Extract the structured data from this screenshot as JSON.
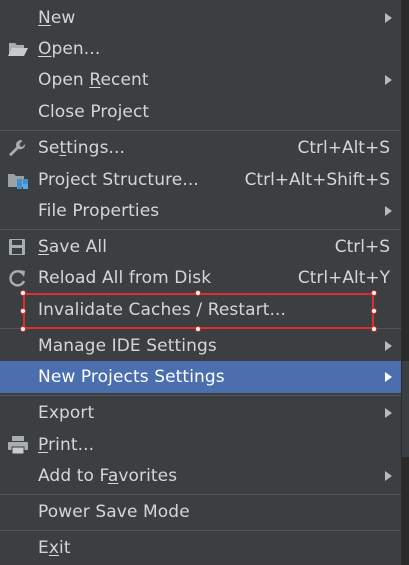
{
  "menu": {
    "items": [
      {
        "id": "new",
        "pre": "",
        "u": "N",
        "post": "ew",
        "shortcut": "",
        "submenu": true,
        "icon": "none"
      },
      {
        "id": "open",
        "pre": "",
        "u": "O",
        "post": "pen...",
        "shortcut": "",
        "submenu": false,
        "icon": "folder-open-icon"
      },
      {
        "id": "open-recent",
        "pre": "Open ",
        "u": "R",
        "post": "ecent",
        "shortcut": "",
        "submenu": true,
        "icon": "none"
      },
      {
        "id": "close-project",
        "pre": "Close Project",
        "u": "",
        "post": "",
        "shortcut": "",
        "submenu": false,
        "icon": "none"
      },
      {
        "id": "settings",
        "pre": "Se",
        "u": "t",
        "post": "tings...",
        "shortcut": "Ctrl+Alt+S",
        "submenu": false,
        "icon": "wrench-icon"
      },
      {
        "id": "project-structure",
        "pre": "Project Structure...",
        "u": "",
        "post": "",
        "shortcut": "Ctrl+Alt+Shift+S",
        "submenu": false,
        "icon": "project-structure-icon"
      },
      {
        "id": "file-properties",
        "pre": "File Properties",
        "u": "",
        "post": "",
        "shortcut": "",
        "submenu": true,
        "icon": "none"
      },
      {
        "id": "save-all",
        "pre": "",
        "u": "S",
        "post": "ave All",
        "shortcut": "Ctrl+S",
        "submenu": false,
        "icon": "save-icon"
      },
      {
        "id": "reload-all",
        "pre": "Reload All from Disk",
        "u": "",
        "post": "",
        "shortcut": "Ctrl+Alt+Y",
        "submenu": false,
        "icon": "reload-icon"
      },
      {
        "id": "invalidate-caches",
        "pre": "Invalidate Caches / Restart...",
        "u": "",
        "post": "",
        "shortcut": "",
        "submenu": false,
        "icon": "none"
      },
      {
        "id": "manage-ide-settings",
        "pre": "Manage IDE Settings",
        "u": "",
        "post": "",
        "shortcut": "",
        "submenu": true,
        "icon": "none"
      },
      {
        "id": "new-projects-settings",
        "pre": "New Projects Settings",
        "u": "",
        "post": "",
        "shortcut": "",
        "submenu": true,
        "icon": "none",
        "selected": true
      },
      {
        "id": "export",
        "pre": "Export",
        "u": "",
        "post": "",
        "shortcut": "",
        "submenu": true,
        "icon": "none"
      },
      {
        "id": "print",
        "pre": "",
        "u": "P",
        "post": "rint...",
        "shortcut": "",
        "submenu": false,
        "icon": "print-icon"
      },
      {
        "id": "add-to-favorites",
        "pre": "Add to F",
        "u": "a",
        "post": "vorites",
        "shortcut": "",
        "submenu": true,
        "icon": "none"
      },
      {
        "id": "power-save-mode",
        "pre": "Power Save Mode",
        "u": "",
        "post": "",
        "shortcut": "",
        "submenu": false,
        "icon": "none"
      },
      {
        "id": "exit",
        "pre": "E",
        "u": "x",
        "post": "it",
        "shortcut": "",
        "submenu": false,
        "icon": "none"
      }
    ]
  },
  "colors": {
    "background": "#3c3f41",
    "text": "#d6d6d6",
    "selection": "#4b6eaf",
    "separator": "#515658",
    "annotation": "#e12d2d"
  }
}
